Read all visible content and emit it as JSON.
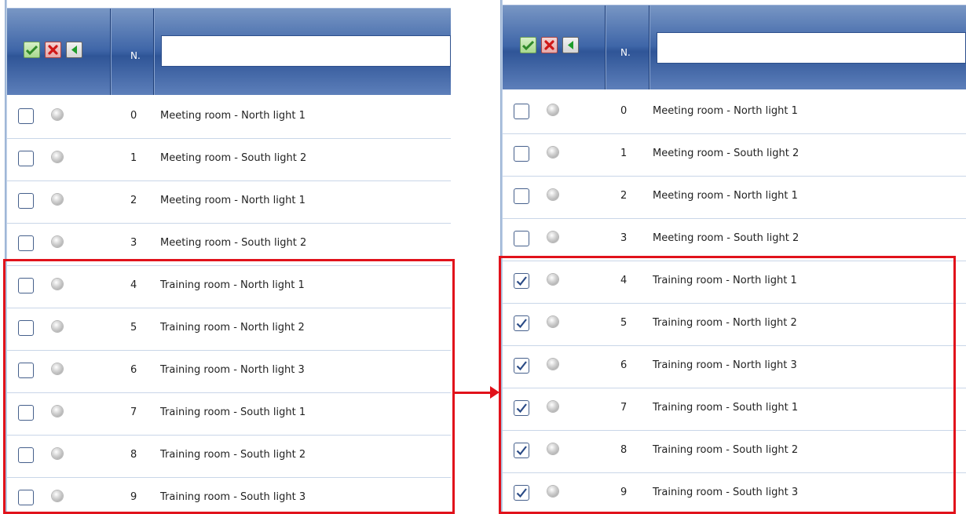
{
  "header": {
    "n_label": "N.",
    "search_value": ""
  },
  "icons": {
    "confirm": "checkmark-icon",
    "cancel": "close-icon",
    "back": "back-arrow-icon"
  },
  "colors": {
    "header_blue": "#3f66a8",
    "highlight_red": "#e1121b",
    "row_separator": "#c9d6e8"
  },
  "before": {
    "rows": [
      {
        "n": "0",
        "name": "Meeting room - North light 1",
        "checked": false
      },
      {
        "n": "1",
        "name": "Meeting room - South light  2",
        "checked": false
      },
      {
        "n": "2",
        "name": "Meeting room - North light  1",
        "checked": false
      },
      {
        "n": "3",
        "name": "Meeting room - South light  2",
        "checked": false
      },
      {
        "n": "4",
        "name": "Training room - North light 1",
        "checked": false
      },
      {
        "n": "5",
        "name": "Training room - North light 2",
        "checked": false
      },
      {
        "n": "6",
        "name": "Training room - North light 3",
        "checked": false
      },
      {
        "n": "7",
        "name": "Training room - South light 1",
        "checked": false
      },
      {
        "n": "8",
        "name": "Training room - South light 2",
        "checked": false
      },
      {
        "n": "9",
        "name": "Training room - South light 3",
        "checked": false
      }
    ]
  },
  "after": {
    "rows": [
      {
        "n": "0",
        "name": "Meeting room - North light 1",
        "checked": false
      },
      {
        "n": "1",
        "name": "Meeting room - South light  2",
        "checked": false
      },
      {
        "n": "2",
        "name": "Meeting room - North light  1",
        "checked": false
      },
      {
        "n": "3",
        "name": "Meeting room - South light  2",
        "checked": false
      },
      {
        "n": "4",
        "name": "Training room - North light 1",
        "checked": true
      },
      {
        "n": "5",
        "name": "Training room - North light 2",
        "checked": true
      },
      {
        "n": "6",
        "name": "Training room - North light 3",
        "checked": true
      },
      {
        "n": "7",
        "name": "Training room - South light 1",
        "checked": true
      },
      {
        "n": "8",
        "name": "Training room - South light 2",
        "checked": true
      },
      {
        "n": "9",
        "name": "Training room - South light 3",
        "checked": true
      }
    ]
  }
}
